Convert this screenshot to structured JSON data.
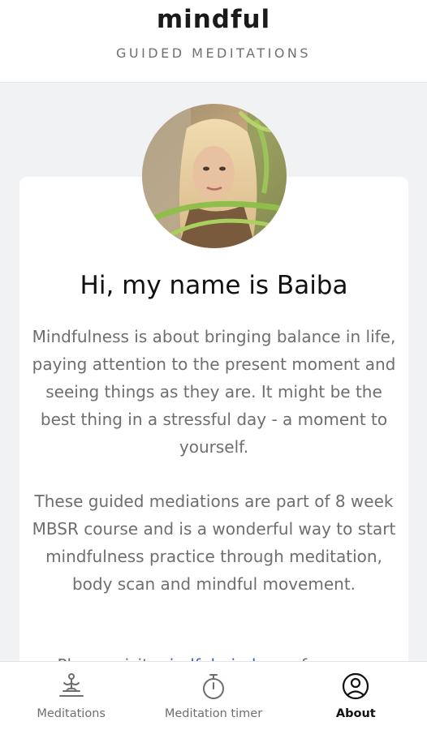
{
  "header": {
    "title": "mindful",
    "subtitle": "GUIDED MEDITATIONS"
  },
  "profile": {
    "avatar_icon": "profile-photo",
    "greeting": "Hi, my name is Baiba",
    "bio_paragraph_1": "Mindfulness is about bringing balance in life, paying attention to the present moment and seeing things as they are. It might be the best thing in a stressful day - a moment to yourself.",
    "bio_paragraph_2": "These guided mediations are part of 8 week MBSR course and is a wonderful way to start mindfulness practice through meditation, body scan and mindful movement.",
    "bio_paragraph_3_prefix": "Please visit ",
    "bio_paragraph_3_link": "mindfulmind.com",
    "bio_paragraph_3_suffix": " for more"
  },
  "tabs": [
    {
      "label": "Meditations",
      "icon": "meditation-pose-icon",
      "active": false
    },
    {
      "label": "Meditation timer",
      "icon": "stopwatch-icon",
      "active": false
    },
    {
      "label": "About",
      "icon": "user-circle-icon",
      "active": true
    }
  ],
  "colors": {
    "link": "#3a63c9",
    "text_muted": "#6e6e6e",
    "background": "#f1f2f4"
  }
}
